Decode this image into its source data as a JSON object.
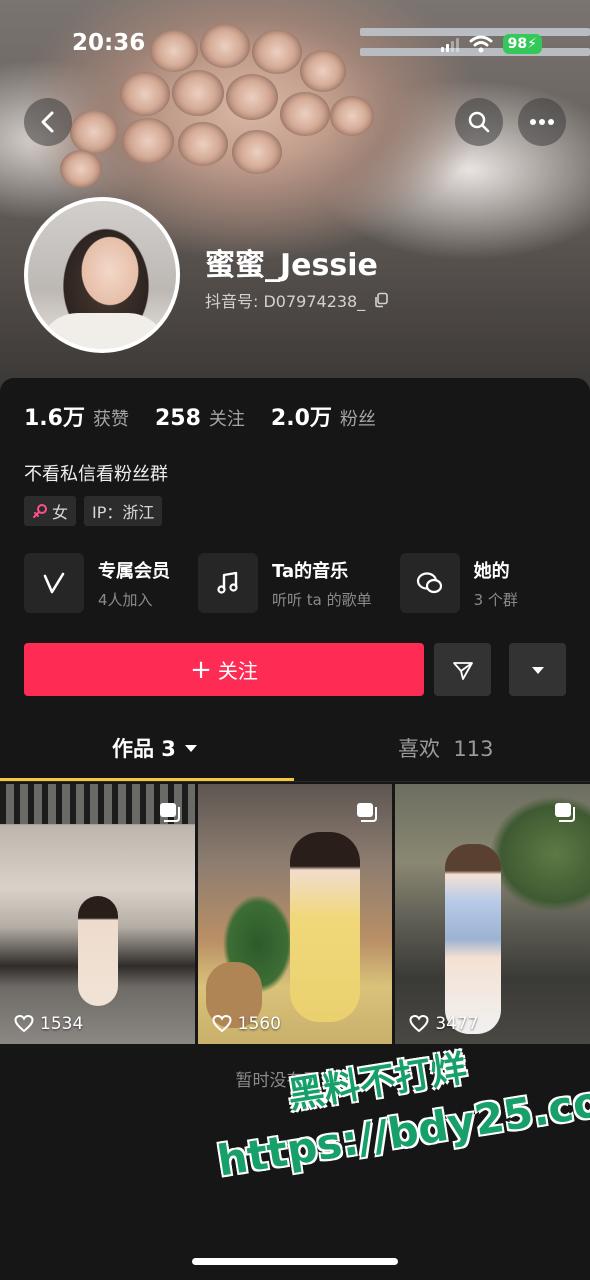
{
  "status_bar": {
    "time": "20:36",
    "battery": "98"
  },
  "profile": {
    "username": "蜜蜜_Jessie",
    "douyin_id": "抖音号: D07974238_"
  },
  "stats": [
    {
      "num": "1.6万",
      "label": "获赞"
    },
    {
      "num": "258",
      "label": "关注"
    },
    {
      "num": "2.0万",
      "label": "粉丝"
    }
  ],
  "bio": "不看私信看粉丝群",
  "tags": {
    "gender": "女",
    "ip": "IP：浙江"
  },
  "features": [
    {
      "title": "专属会员",
      "subtitle": "4人加入",
      "icon": "v-icon"
    },
    {
      "title": "Ta的音乐",
      "subtitle": "听听 ta 的歌单",
      "icon": "music-note-icon"
    },
    {
      "title": "她的",
      "subtitle": "3 个群",
      "icon": "chat-bubbles-icon"
    }
  ],
  "actions": {
    "follow_label": "关注"
  },
  "tabs": {
    "works_label": "作品 3",
    "likes_label": "喜欢  113"
  },
  "videos": [
    {
      "likes": "1534"
    },
    {
      "likes": "1560"
    },
    {
      "likes": "3477"
    }
  ],
  "footer": {
    "no_more": "暂时没有更多了"
  },
  "watermark": {
    "line1": "黑料不打烊",
    "line2": "https://bdy25.co"
  },
  "colors": {
    "accent": "#fe2c55",
    "tab_underline": "#f6c93c",
    "battery": "#34c759"
  }
}
